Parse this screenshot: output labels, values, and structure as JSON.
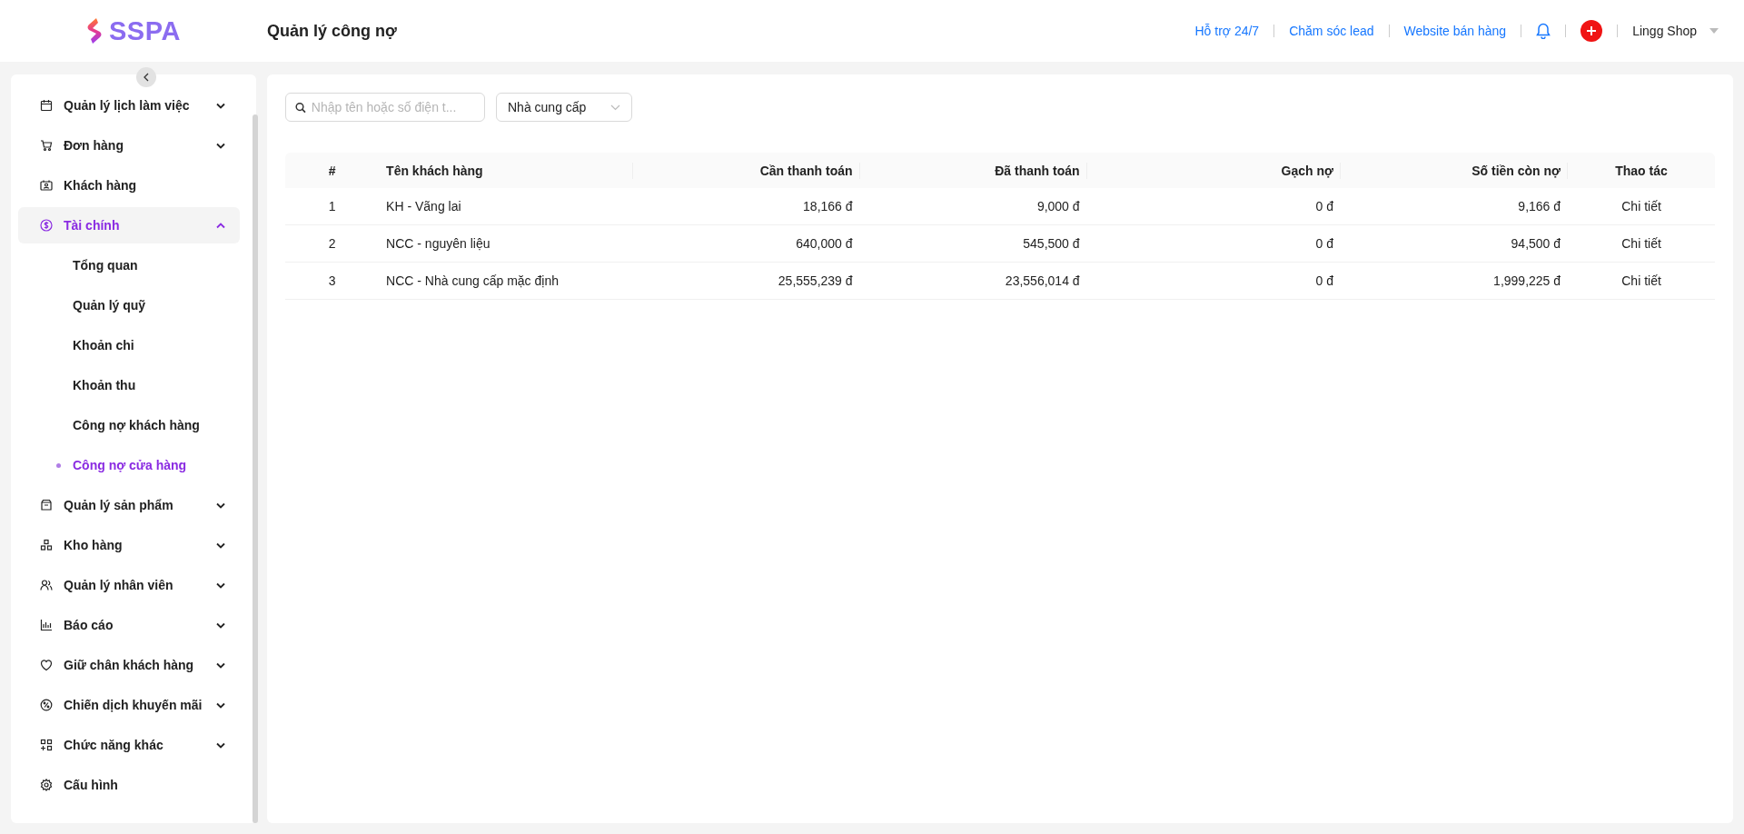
{
  "header": {
    "logo_text": "SSPA",
    "page_title": "Quản lý công nợ",
    "links": [
      "Hỗ trợ 24/7",
      "Chăm sóc lead",
      "Website bán hàng"
    ],
    "account": "Lingg Shop"
  },
  "sidebar": {
    "items": [
      {
        "label": "Quản lý lịch làm việc",
        "selected": false,
        "expanded": false
      },
      {
        "label": "Đơn hàng",
        "selected": false,
        "expanded": false
      },
      {
        "label": "Khách hàng",
        "selected": false
      },
      {
        "label": "Tài chính",
        "selected": true,
        "expanded": true,
        "children": [
          {
            "label": "Tổng quan",
            "selected": false
          },
          {
            "label": "Quản lý quỹ",
            "selected": false
          },
          {
            "label": "Khoản chi",
            "selected": false
          },
          {
            "label": "Khoản thu",
            "selected": false
          },
          {
            "label": "Công nợ khách hàng",
            "selected": false
          },
          {
            "label": "Công nợ cửa hàng",
            "selected": true
          }
        ]
      },
      {
        "label": "Quản lý sản phẩm",
        "selected": false,
        "expanded": false
      },
      {
        "label": "Kho hàng",
        "selected": false,
        "expanded": false
      },
      {
        "label": "Quản lý nhân viên",
        "selected": false,
        "expanded": false
      },
      {
        "label": "Báo cáo",
        "selected": false,
        "expanded": false
      },
      {
        "label": "Giữ chân khách hàng",
        "selected": false,
        "expanded": false
      },
      {
        "label": "Chiến dịch khuyến mãi",
        "selected": false,
        "expanded": false
      },
      {
        "label": "Chức năng khác",
        "selected": false,
        "expanded": false
      },
      {
        "label": "Cấu hình",
        "selected": false
      }
    ]
  },
  "filters": {
    "search": {
      "placeholder": "Nhập tên hoặc số điện t..."
    },
    "type_select": {
      "value": "Nhà cung cấp"
    }
  },
  "table": {
    "columns": [
      "#",
      "Tên khách hàng",
      "Cần thanh toán",
      "Đã thanh toán",
      "Gạch nợ",
      "Số tiền còn nợ",
      "Thao tác"
    ],
    "rows": [
      {
        "index": "1",
        "name": "KH - Vãng lai",
        "to_pay": "18,166 đ",
        "paid": "9,000 đ",
        "written_off": "0 đ",
        "remaining": "9,166 đ",
        "action": "Chi tiết"
      },
      {
        "index": "2",
        "name": "NCC - nguyên liệu",
        "to_pay": "640,000 đ",
        "paid": "545,500 đ",
        "written_off": "0 đ",
        "remaining": "94,500 đ",
        "action": "Chi tiết"
      },
      {
        "index": "3",
        "name": "NCC - Nhà cung cấp mặc định",
        "to_pay": "25,555,239 đ",
        "paid": "23,556,014 đ",
        "written_off": "0 đ",
        "remaining": "1,999,225 đ",
        "action": "Chi tiết"
      }
    ]
  }
}
